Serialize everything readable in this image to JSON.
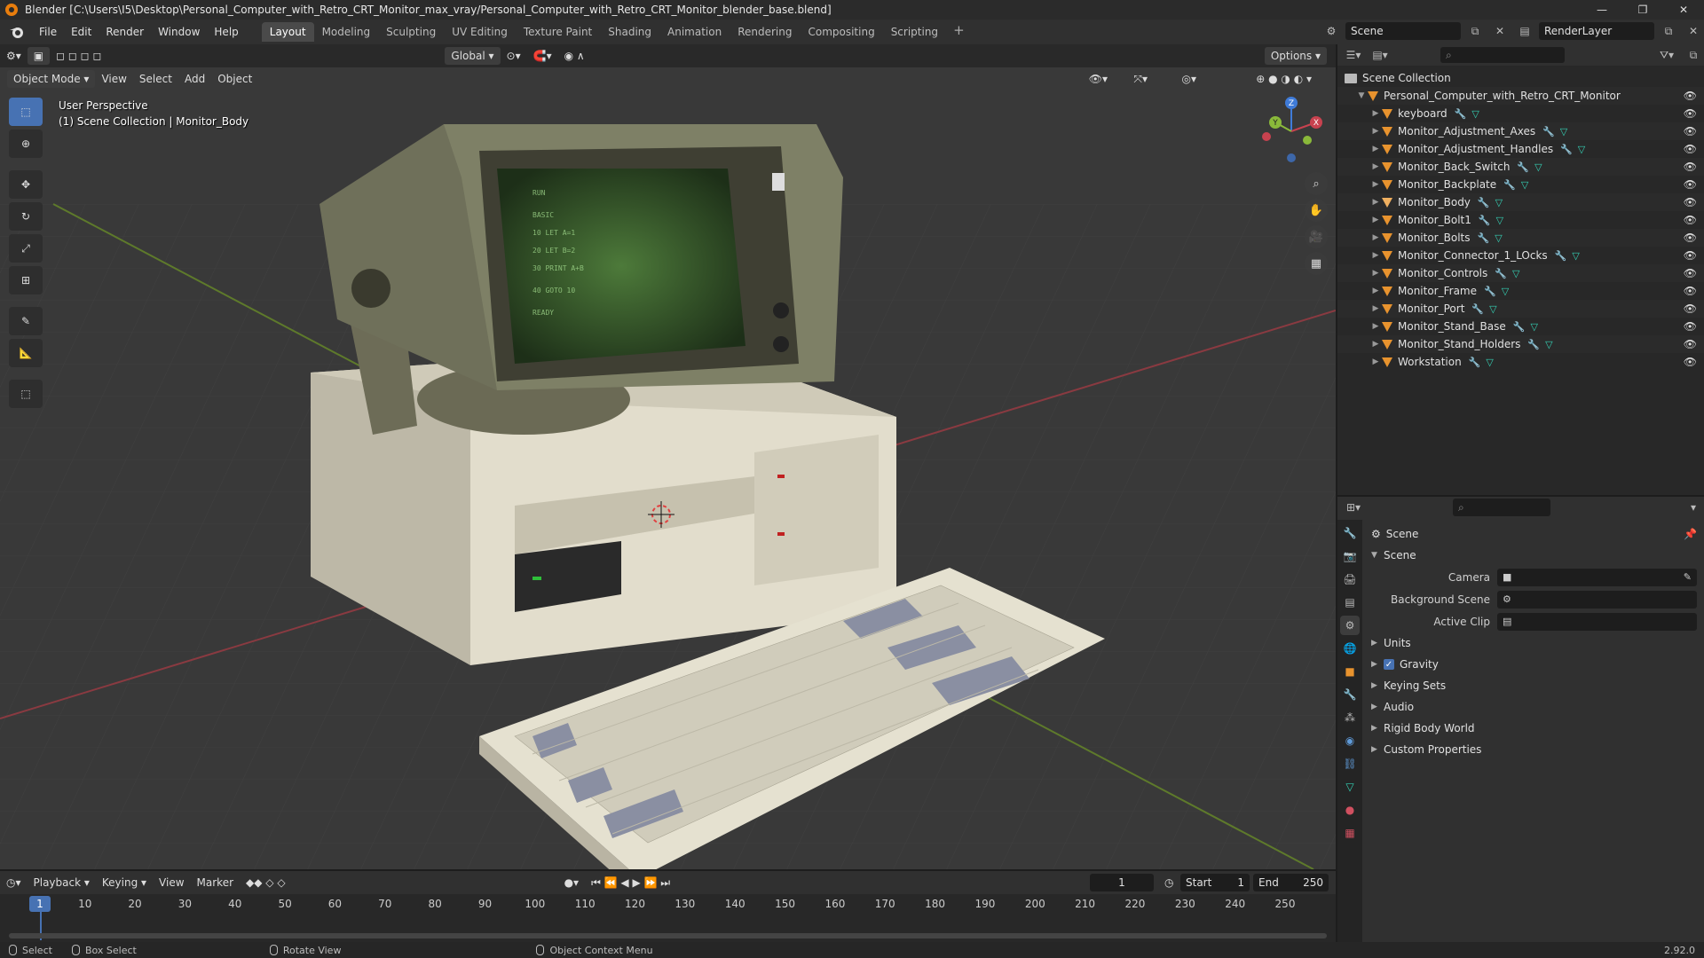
{
  "window": {
    "title": "Blender [C:\\Users\\I5\\Desktop\\Personal_Computer_with_Retro_CRT_Monitor_max_vray/Personal_Computer_with_Retro_CRT_Monitor_blender_base.blend]",
    "minimize": "—",
    "maximize": "❐",
    "close": "✕"
  },
  "menu": [
    "File",
    "Edit",
    "Render",
    "Window",
    "Help"
  ],
  "workspaces": [
    "Layout",
    "Modeling",
    "Sculpting",
    "UV Editing",
    "Texture Paint",
    "Shading",
    "Animation",
    "Rendering",
    "Compositing",
    "Scripting"
  ],
  "active_workspace": "Layout",
  "scene_field": "Scene",
  "renderlayer_field": "RenderLayer",
  "viewport": {
    "mode": "Object Mode",
    "menus": [
      "View",
      "Select",
      "Add",
      "Object"
    ],
    "orientation": "Global",
    "options": "Options",
    "info_line1": "User Perspective",
    "info_line2": "(1) Scene Collection | Monitor_Body",
    "gizmo_x": "X",
    "gizmo_y": "Y",
    "gizmo_z": "Z"
  },
  "outliner": {
    "root": "Scene Collection",
    "collection": "Personal_Computer_with_Retro_CRT_Monitor",
    "objects": [
      "keyboard",
      "Monitor_Adjustment_Axes",
      "Monitor_Adjustment_Handles",
      "Monitor_Back_Switch",
      "Monitor_Backplate",
      "Monitor_Body",
      "Monitor_Bolt1",
      "Monitor_Bolts",
      "Monitor_Connector_1_LOcks",
      "Monitor_Controls",
      "Monitor_Frame",
      "Monitor_Port",
      "Monitor_Stand_Base",
      "Monitor_Stand_Holders",
      "Workstation"
    ],
    "selected": "Monitor_Body"
  },
  "properties": {
    "context": "Scene",
    "panel": "Scene",
    "fields": [
      {
        "label": "Camera",
        "value": ""
      },
      {
        "label": "Background Scene",
        "value": ""
      },
      {
        "label": "Active Clip",
        "value": ""
      }
    ],
    "subpanels": [
      "Units",
      "Gravity",
      "Keying Sets",
      "Audio",
      "Rigid Body World",
      "Custom Properties"
    ]
  },
  "timeline": {
    "menus": [
      "Playback",
      "Keying",
      "View",
      "Marker"
    ],
    "current_frame": "1",
    "start_label": "Start",
    "start": "1",
    "end_label": "End",
    "end": "250",
    "ruler": [
      "10",
      "20",
      "30",
      "40",
      "50",
      "60",
      "70",
      "80",
      "90",
      "100",
      "110",
      "120",
      "130",
      "140",
      "150",
      "160",
      "170",
      "180",
      "190",
      "200",
      "210",
      "220",
      "230",
      "240",
      "250"
    ]
  },
  "status": {
    "select": "Select",
    "box_select": "Box Select",
    "rotate": "Rotate View",
    "context_menu": "Object Context Menu",
    "version": "2.92.0"
  },
  "colors": {
    "accent": "#4772b3",
    "object_icon": "#e8932e",
    "x_axis": "#c8424f",
    "y_axis": "#8ab93a",
    "z_axis": "#3f7bd8"
  }
}
